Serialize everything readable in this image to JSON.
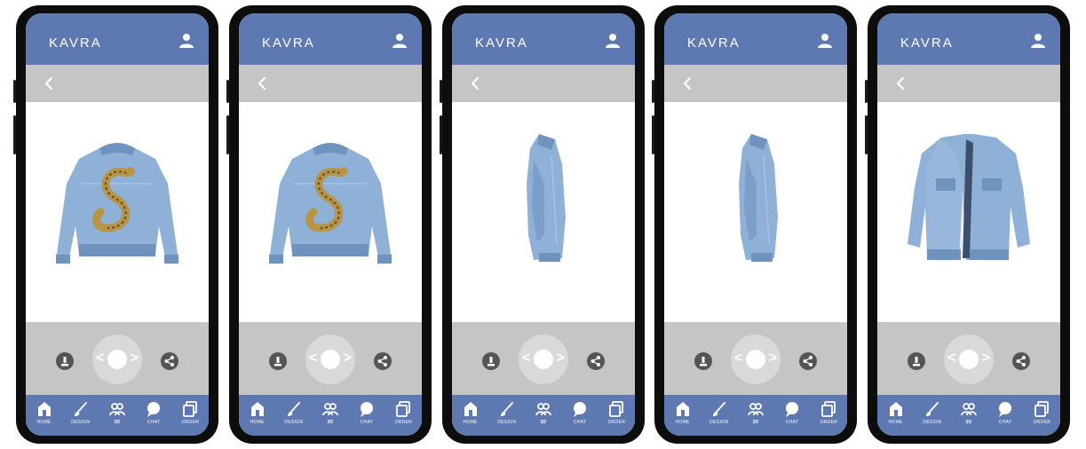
{
  "app": {
    "name": "KAVRA"
  },
  "tabs": [
    {
      "label": "HOME",
      "icon": "home-icon"
    },
    {
      "label": "DESIGN",
      "icon": "brush-icon"
    },
    {
      "label": "3D",
      "icon": "avatar-icon"
    },
    {
      "label": "CHAT",
      "icon": "chat-icon"
    },
    {
      "label": "ORDER",
      "icon": "order-icon"
    }
  ],
  "controls": {
    "left": "<",
    "right": ">"
  },
  "screens": [
    {
      "view": "back"
    },
    {
      "view": "back"
    },
    {
      "view": "side"
    },
    {
      "view": "side"
    },
    {
      "view": "front-angle"
    }
  ],
  "colors": {
    "header": "#5e78b1",
    "toolbar": "#c5c5c5",
    "jacket": "#8fb1d8"
  }
}
